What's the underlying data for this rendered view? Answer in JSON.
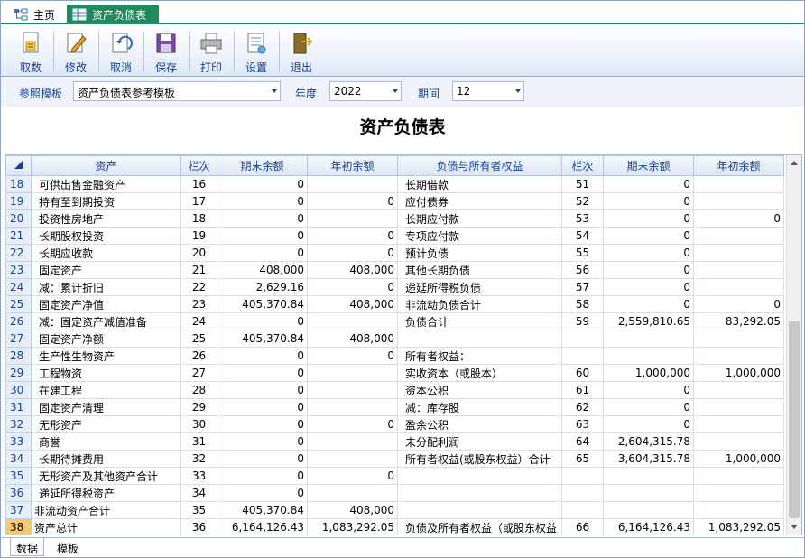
{
  "tabs": {
    "home": "主页",
    "balance_sheet": "资产负债表"
  },
  "toolbar": {
    "fetch": "取数",
    "edit": "修改",
    "cancel": "取消",
    "save": "保存",
    "print": "打印",
    "settings": "设置",
    "exit": "退出"
  },
  "filters": {
    "template_label": "参照模板",
    "template_value": "资产负债表参考模板",
    "year_label": "年度",
    "year_value": "2022",
    "period_label": "期间",
    "period_value": "12"
  },
  "report_title": "资产负债表",
  "grid": {
    "headers": [
      "资产",
      "栏次",
      "期末余额",
      "年初余额",
      "负债与所有者权益",
      "栏次",
      "期末余额",
      "年初余额"
    ],
    "rows": [
      {
        "n": "18",
        "a": "可供出售金融资产",
        "ai": 1,
        "al": "16",
        "ae": "0",
        "ab": "",
        "l": "长期借款",
        "li": 0,
        "ll": "51",
        "le": "0",
        "lb": ""
      },
      {
        "n": "19",
        "a": "持有至到期投资",
        "ai": 1,
        "al": "17",
        "ae": "0",
        "ab": "0",
        "l": "应付债券",
        "li": 0,
        "ll": "52",
        "le": "0",
        "lb": ""
      },
      {
        "n": "20",
        "a": "投资性房地产",
        "ai": 1,
        "al": "18",
        "ae": "0",
        "ab": "",
        "l": "长期应付款",
        "li": 0,
        "ll": "53",
        "le": "0",
        "lb": "0"
      },
      {
        "n": "21",
        "a": "长期股权投资",
        "ai": 1,
        "al": "19",
        "ae": "0",
        "ab": "0",
        "l": "专项应付款",
        "li": 0,
        "ll": "54",
        "le": "0",
        "lb": ""
      },
      {
        "n": "22",
        "a": "长期应收款",
        "ai": 1,
        "al": "20",
        "ae": "0",
        "ab": "0",
        "l": "预计负债",
        "li": 0,
        "ll": "55",
        "le": "0",
        "lb": ""
      },
      {
        "n": "23",
        "a": "固定资产",
        "ai": 1,
        "al": "21",
        "ae": "408,000",
        "ab": "408,000",
        "l": "其他长期负债",
        "li": 0,
        "ll": "56",
        "le": "0",
        "lb": ""
      },
      {
        "n": "24",
        "a": "减：累计折旧",
        "ai": 1,
        "al": "22",
        "ae": "2,629.16",
        "ab": "0",
        "l": "递延所得税负债",
        "li": 0,
        "ll": "57",
        "le": "0",
        "lb": ""
      },
      {
        "n": "25",
        "a": "固定资产净值",
        "ai": 1,
        "al": "23",
        "ae": "405,370.84",
        "ab": "408,000",
        "l": "非流动负债合计",
        "li": 0,
        "ll": "58",
        "le": "0",
        "lb": "0"
      },
      {
        "n": "26",
        "a": "减：固定资产减值准备",
        "ai": 1,
        "al": "24",
        "ae": "0",
        "ab": "",
        "l": "负债合计",
        "li": 0,
        "ll": "59",
        "le": "2,559,810.65",
        "lb": "83,292.05"
      },
      {
        "n": "27",
        "a": "固定资产净额",
        "ai": 1,
        "al": "25",
        "ae": "405,370.84",
        "ab": "408,000",
        "l": "",
        "li": 0,
        "ll": "",
        "le": "",
        "lb": ""
      },
      {
        "n": "28",
        "a": "生产性生物资产",
        "ai": 1,
        "al": "26",
        "ae": "0",
        "ab": "0",
        "l": "所有者权益：",
        "li": 0,
        "ll": "",
        "le": "",
        "lb": ""
      },
      {
        "n": "29",
        "a": "工程物资",
        "ai": 1,
        "al": "27",
        "ae": "0",
        "ab": "",
        "l": "实收资本（或股本）",
        "li": 0,
        "ll": "60",
        "le": "1,000,000",
        "lb": "1,000,000"
      },
      {
        "n": "30",
        "a": "在建工程",
        "ai": 1,
        "al": "28",
        "ae": "0",
        "ab": "",
        "l": "资本公积",
        "li": 0,
        "ll": "61",
        "le": "0",
        "lb": ""
      },
      {
        "n": "31",
        "a": "固定资产清理",
        "ai": 1,
        "al": "29",
        "ae": "0",
        "ab": "",
        "l": "减：库存股",
        "li": 0,
        "ll": "62",
        "le": "0",
        "lb": ""
      },
      {
        "n": "32",
        "a": "无形资产",
        "ai": 1,
        "al": "30",
        "ae": "0",
        "ab": "0",
        "l": "盈余公积",
        "li": 0,
        "ll": "63",
        "le": "0",
        "lb": ""
      },
      {
        "n": "33",
        "a": "商誉",
        "ai": 1,
        "al": "31",
        "ae": "0",
        "ab": "",
        "l": "未分配利润",
        "li": 0,
        "ll": "64",
        "le": "2,604,315.78",
        "lb": ""
      },
      {
        "n": "34",
        "a": "长期待摊费用",
        "ai": 1,
        "al": "32",
        "ae": "0",
        "ab": "",
        "l": "所有者权益(或股东权益）合计",
        "li": 0,
        "ll": "65",
        "le": "3,604,315.78",
        "lb": "1,000,000"
      },
      {
        "n": "35",
        "a": "无形资产及其他资产合计",
        "ai": 1,
        "al": "33",
        "ae": "0",
        "ab": "0",
        "l": "",
        "li": 0,
        "ll": "",
        "le": "",
        "lb": ""
      },
      {
        "n": "36",
        "a": "递延所得税资产",
        "ai": 1,
        "al": "34",
        "ae": "0",
        "ab": "",
        "l": "",
        "li": 0,
        "ll": "",
        "le": "",
        "lb": ""
      },
      {
        "n": "37",
        "a": "非流动资产合计",
        "ai": 0,
        "al": "35",
        "ae": "405,370.84",
        "ab": "408,000",
        "l": "",
        "li": 0,
        "ll": "",
        "le": "",
        "lb": ""
      },
      {
        "n": "38",
        "a": "资产总计",
        "ai": 0,
        "al": "36",
        "ae": "6,164,126.43",
        "ab": "1,083,292.05",
        "l": "负债及所有者权益（或股东权益",
        "li": 0,
        "ll": "66",
        "le": "6,164,126.43",
        "lb": "1,083,292.05",
        "active": true
      }
    ]
  },
  "bottom_tabs": {
    "data": "数据",
    "template": "模板"
  },
  "colors": {
    "accent": "#1f8a5b",
    "header_text": "#15428b",
    "active_row": "#f7c96b"
  }
}
